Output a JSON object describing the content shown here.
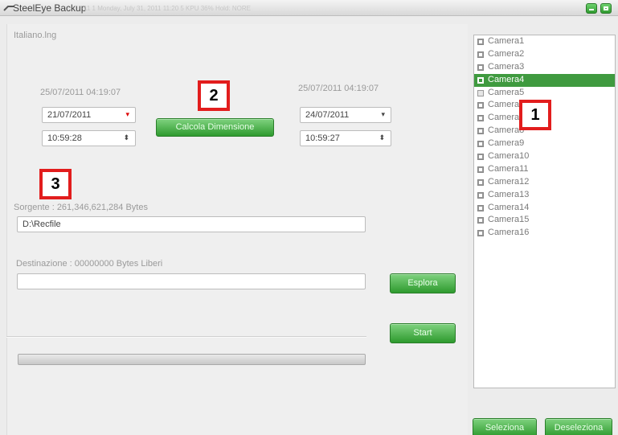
{
  "window": {
    "title": "SteelEye Backup",
    "ghost_text": "11    1    Monday, July 31, 2011  11:20    5 KPU 36%    Hold: NORE"
  },
  "language_file": "Italiano.lng",
  "start": {
    "timestamp": "25/07/2011 04:19:07",
    "date": "21/07/2011",
    "time": "10:59:28"
  },
  "end": {
    "timestamp": "25/07/2011 04:19:07",
    "date": "24/07/2011",
    "time": "10:59:27"
  },
  "buttons": {
    "calcola": "Calcola Dimensione",
    "esplora": "Esplora",
    "start": "Start",
    "seleziona": "Seleziona",
    "deseleziona": "Deseleziona"
  },
  "source": {
    "label": "Sorgente : 261,346,621,284 Bytes",
    "path": "D:\\Recfile"
  },
  "destination": {
    "label": "Destinazione : 00000000 Bytes Liberi",
    "path": ""
  },
  "badges": [
    "1",
    "2",
    "3"
  ],
  "cameras": [
    {
      "label": "Camera1",
      "checked": true,
      "selected": false
    },
    {
      "label": "Camera2",
      "checked": true,
      "selected": false
    },
    {
      "label": "Camera3",
      "checked": true,
      "selected": false
    },
    {
      "label": "Camera4",
      "checked": true,
      "selected": true
    },
    {
      "label": "Camera5",
      "checked": false,
      "selected": false
    },
    {
      "label": "Camera6",
      "checked": true,
      "selected": false
    },
    {
      "label": "Camera7",
      "checked": true,
      "selected": false
    },
    {
      "label": "Camera8",
      "checked": true,
      "selected": false
    },
    {
      "label": "Camera9",
      "checked": true,
      "selected": false
    },
    {
      "label": "Camera10",
      "checked": true,
      "selected": false
    },
    {
      "label": "Camera11",
      "checked": true,
      "selected": false
    },
    {
      "label": "Camera12",
      "checked": true,
      "selected": false
    },
    {
      "label": "Camera13",
      "checked": true,
      "selected": false
    },
    {
      "label": "Camera14",
      "checked": true,
      "selected": false
    },
    {
      "label": "Camera15",
      "checked": true,
      "selected": false
    },
    {
      "label": "Camera16",
      "checked": true,
      "selected": false
    }
  ],
  "colors": {
    "accent_green": "#3f9a3f",
    "badge_border": "#e21d1d"
  }
}
